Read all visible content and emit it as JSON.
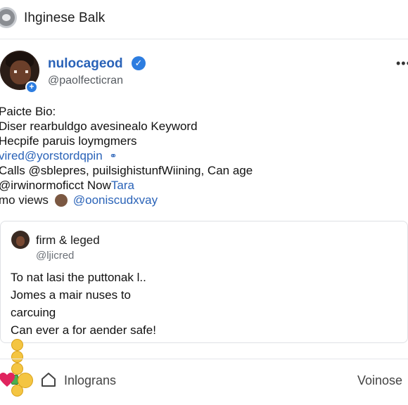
{
  "header": {
    "title": "Ihginese Balk"
  },
  "profile": {
    "name": "nulocageod",
    "handle": "@paolfecticran",
    "bio_heading": "Paicte Bio:",
    "bio_lines": [
      "Diser rearbuldgo avesinealo Keyword",
      "Hecpife paruis loymgmers"
    ],
    "bio_link": "vired@yorstordqpin",
    "bio_line_calls": "Calls @sblepres, puilsighistunfWiining, Can age",
    "bio_line_now_prefix": "@irwinormoficct Now ",
    "bio_line_now_link": "Tara",
    "views_label": "mo views",
    "views_link": "@ooniscudxvay"
  },
  "quote": {
    "name": "firm & leged",
    "handle": "@ljicred",
    "lines": [
      "To nat lasi the puttonak l..",
      "Jomes a mair nuses to",
      "carcuing",
      "Can ever a for aender safe!"
    ]
  },
  "actions": {
    "label": "Inlograns",
    "right_label": "Voinose"
  },
  "colors": {
    "accent": "#2a63b8",
    "verified": "#2d7de0",
    "heart": "#e0245e"
  }
}
